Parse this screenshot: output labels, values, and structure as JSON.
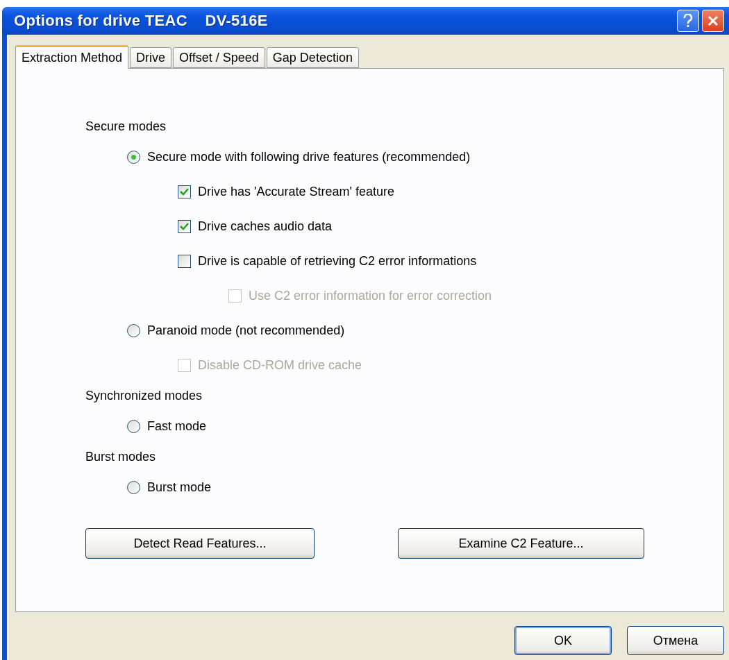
{
  "window": {
    "title": "Options for drive TEAC    DV-516E"
  },
  "tabs": [
    {
      "label": "Extraction Method",
      "selected": true
    },
    {
      "label": "Drive",
      "selected": false
    },
    {
      "label": "Offset / Speed",
      "selected": false
    },
    {
      "label": "Gap Detection",
      "selected": false
    }
  ],
  "sections": [
    {
      "heading": "Secure modes",
      "options": [
        {
          "kind": "radio",
          "label": "Secure mode with following drive features (recommended)",
          "selected": true,
          "children": [
            {
              "kind": "checkbox",
              "label": "Drive has 'Accurate Stream' feature",
              "checked": true,
              "disabled": false
            },
            {
              "kind": "checkbox",
              "label": "Drive caches audio data",
              "checked": true,
              "disabled": false
            },
            {
              "kind": "checkbox",
              "label": "Drive is capable of retrieving C2 error informations",
              "checked": false,
              "disabled": false,
              "children": [
                {
                  "kind": "checkbox",
                  "label": "Use C2 error information for error correction",
                  "checked": false,
                  "disabled": true
                }
              ]
            }
          ]
        },
        {
          "kind": "radio",
          "label": "Paranoid mode (not recommended)",
          "selected": false,
          "children": [
            {
              "kind": "checkbox",
              "label": "Disable CD-ROM drive cache",
              "checked": false,
              "disabled": true
            }
          ]
        }
      ]
    },
    {
      "heading": "Synchronized modes",
      "options": [
        {
          "kind": "radio",
          "label": "Fast mode",
          "selected": false
        }
      ]
    },
    {
      "heading": "Burst modes",
      "options": [
        {
          "kind": "radio",
          "label": "Burst mode",
          "selected": false
        }
      ]
    }
  ],
  "panel_buttons": [
    "Detect Read Features...",
    "Examine C2 Feature..."
  ],
  "dialog_buttons": [
    {
      "label": "OK",
      "default": true
    },
    {
      "label": "Отмена",
      "default": false
    }
  ]
}
